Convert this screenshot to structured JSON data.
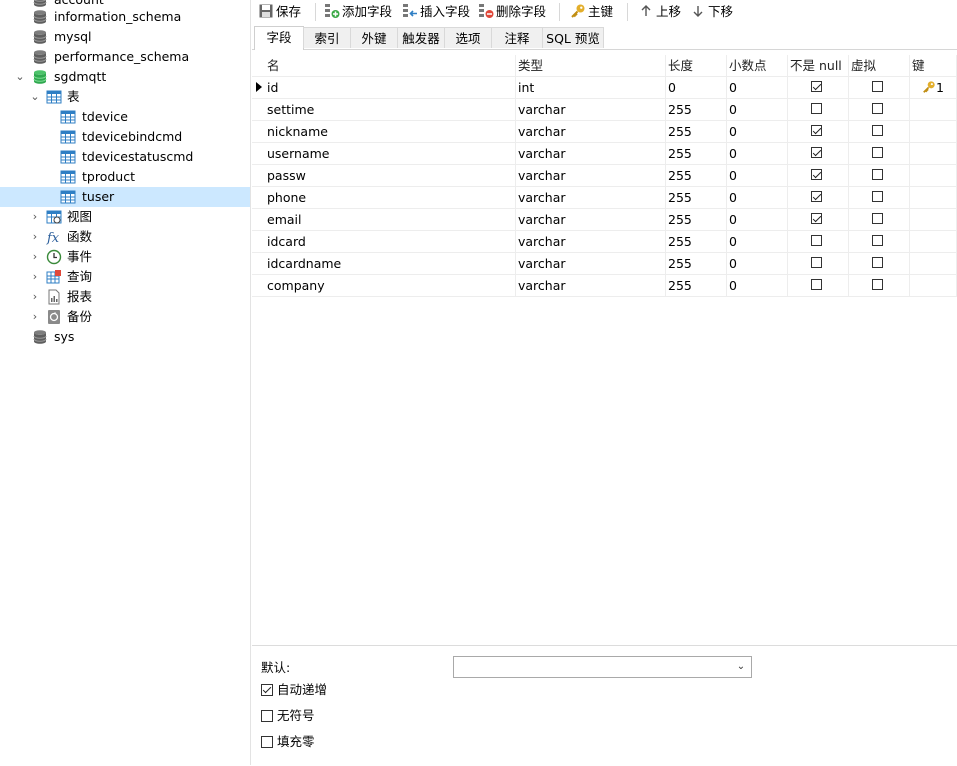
{
  "sidebar": {
    "items": [
      {
        "label": "account",
        "icon": "database-icon"
      },
      {
        "label": "information_schema",
        "icon": "database-icon"
      },
      {
        "label": "mysql",
        "icon": "database-icon"
      },
      {
        "label": "performance_schema",
        "icon": "database-icon"
      },
      {
        "label": "sgdmqtt",
        "icon": "database-open-icon"
      },
      {
        "label": "表",
        "icon": "tables-icon"
      },
      {
        "label": "tdevice",
        "icon": "table-icon"
      },
      {
        "label": "tdevicebindcmd",
        "icon": "table-icon"
      },
      {
        "label": "tdevicestatuscmd",
        "icon": "table-icon"
      },
      {
        "label": "tproduct",
        "icon": "table-icon"
      },
      {
        "label": "tuser",
        "icon": "table-icon"
      },
      {
        "label": "视图",
        "icon": "view-icon"
      },
      {
        "label": "函数",
        "icon": "function-icon"
      },
      {
        "label": "事件",
        "icon": "event-clock-icon"
      },
      {
        "label": "查询",
        "icon": "query-icon"
      },
      {
        "label": "报表",
        "icon": "report-icon"
      },
      {
        "label": "备份",
        "icon": "backup-icon"
      },
      {
        "label": "sys",
        "icon": "database-icon"
      }
    ]
  },
  "toolbar": {
    "save": "保存",
    "add_field": "添加字段",
    "insert_field": "插入字段",
    "delete_field": "删除字段",
    "primary_key": "主键",
    "move_up": "上移",
    "move_down": "下移"
  },
  "tabs": [
    "字段",
    "索引",
    "外键",
    "触发器",
    "选项",
    "注释",
    "SQL 预览"
  ],
  "grid": {
    "headers": [
      "名",
      "类型",
      "长度",
      "小数点",
      "不是 null",
      "虚拟",
      "键"
    ],
    "rows": [
      {
        "name": "id",
        "type": "int",
        "length": "0",
        "decimals": "0",
        "not_null": true,
        "virtual": false,
        "key": "1"
      },
      {
        "name": "settime",
        "type": "varchar",
        "length": "255",
        "decimals": "0",
        "not_null": false,
        "virtual": false,
        "key": ""
      },
      {
        "name": "nickname",
        "type": "varchar",
        "length": "255",
        "decimals": "0",
        "not_null": true,
        "virtual": false,
        "key": ""
      },
      {
        "name": "username",
        "type": "varchar",
        "length": "255",
        "decimals": "0",
        "not_null": true,
        "virtual": false,
        "key": ""
      },
      {
        "name": "passw",
        "type": "varchar",
        "length": "255",
        "decimals": "0",
        "not_null": true,
        "virtual": false,
        "key": ""
      },
      {
        "name": "phone",
        "type": "varchar",
        "length": "255",
        "decimals": "0",
        "not_null": true,
        "virtual": false,
        "key": ""
      },
      {
        "name": "email",
        "type": "varchar",
        "length": "255",
        "decimals": "0",
        "not_null": true,
        "virtual": false,
        "key": ""
      },
      {
        "name": "idcard",
        "type": "varchar",
        "length": "255",
        "decimals": "0",
        "not_null": false,
        "virtual": false,
        "key": ""
      },
      {
        "name": "idcardname",
        "type": "varchar",
        "length": "255",
        "decimals": "0",
        "not_null": false,
        "virtual": false,
        "key": ""
      },
      {
        "name": "company",
        "type": "varchar",
        "length": "255",
        "decimals": "0",
        "not_null": false,
        "virtual": false,
        "key": ""
      }
    ]
  },
  "props": {
    "default_label": "默认:",
    "default_value": "",
    "auto_increment_label": "自动递增",
    "auto_increment": true,
    "unsigned_label": "无符号",
    "unsigned": false,
    "zerofill_label": "填充零",
    "zerofill": false
  },
  "colors": {
    "selection": "#cce8ff",
    "db_green": "#2fa84f",
    "table_blue": "#2f7fc4",
    "key_gold": "#d9a21c"
  }
}
